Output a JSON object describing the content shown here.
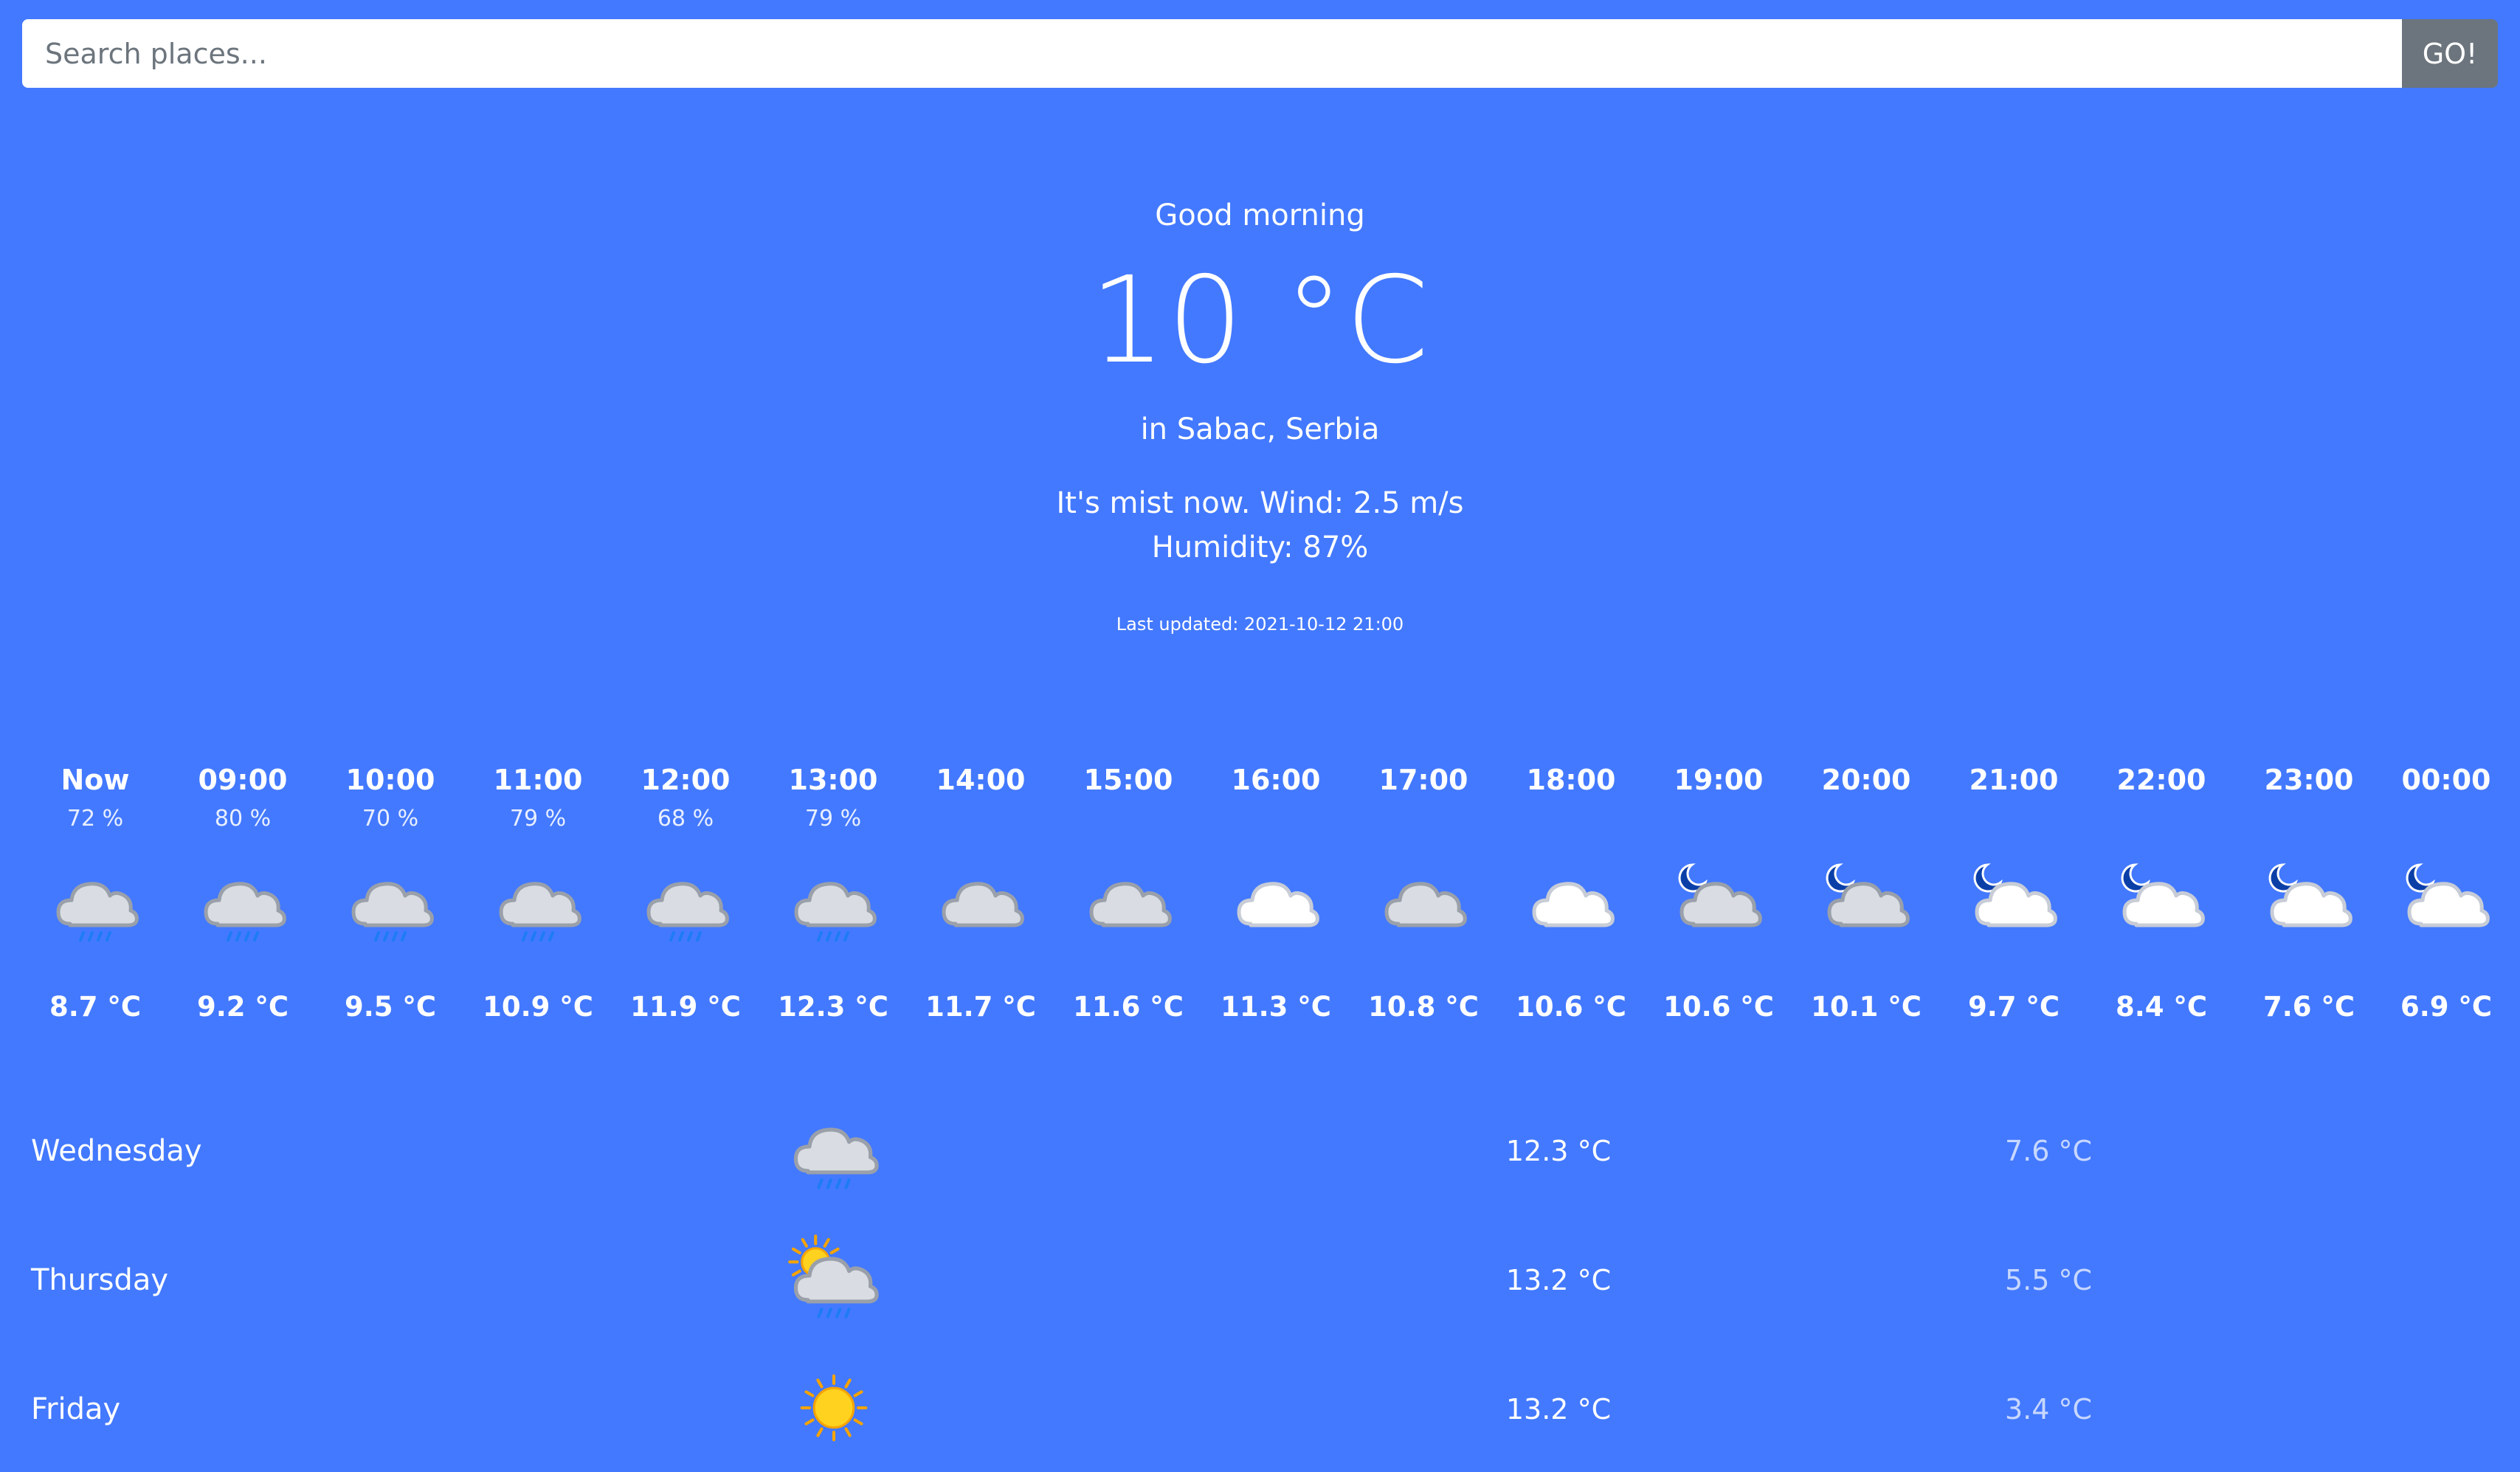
{
  "search": {
    "placeholder": "Search places...",
    "button_label": "GO!"
  },
  "current": {
    "greeting": "Good morning",
    "temperature": "10 °C",
    "location": "in Sabac, Serbia",
    "conditions": "It's mist now. Wind: 2.5 m/s",
    "humidity": "Humidity: 87%",
    "last_updated": "Last updated: 2021-10-12 21:00"
  },
  "hourly": [
    {
      "time": "Now",
      "humidity": "72 %",
      "icon": "rain-cloud-icon",
      "temp": "8.7 °C"
    },
    {
      "time": "09:00",
      "humidity": "80 %",
      "icon": "rain-cloud-icon",
      "temp": "9.2 °C"
    },
    {
      "time": "10:00",
      "humidity": "70 %",
      "icon": "rain-cloud-icon",
      "temp": "9.5 °C"
    },
    {
      "time": "11:00",
      "humidity": "79 %",
      "icon": "rain-cloud-icon",
      "temp": "10.9 °C"
    },
    {
      "time": "12:00",
      "humidity": "68 %",
      "icon": "rain-cloud-icon",
      "temp": "11.9 °C"
    },
    {
      "time": "13:00",
      "humidity": "79 %",
      "icon": "rain-cloud-icon",
      "temp": "12.3 °C"
    },
    {
      "time": "14:00",
      "humidity": "",
      "icon": "cloud-icon",
      "temp": "11.7 °C"
    },
    {
      "time": "15:00",
      "humidity": "",
      "icon": "cloud-icon",
      "temp": "11.6 °C"
    },
    {
      "time": "16:00",
      "humidity": "",
      "icon": "white-cloud-icon",
      "temp": "11.3 °C"
    },
    {
      "time": "17:00",
      "humidity": "",
      "icon": "cloud-icon",
      "temp": "10.8 °C"
    },
    {
      "time": "18:00",
      "humidity": "",
      "icon": "white-cloud-icon",
      "temp": "10.6 °C"
    },
    {
      "time": "19:00",
      "humidity": "",
      "icon": "moon-cloud-icon",
      "temp": "10.6 °C"
    },
    {
      "time": "20:00",
      "humidity": "",
      "icon": "moon-cloud-icon",
      "temp": "10.1 °C"
    },
    {
      "time": "21:00",
      "humidity": "",
      "icon": "moon-white-cloud-icon",
      "temp": "9.7 °C"
    },
    {
      "time": "22:00",
      "humidity": "",
      "icon": "moon-white-cloud-icon",
      "temp": "8.4 °C"
    },
    {
      "time": "23:00",
      "humidity": "",
      "icon": "moon-white-cloud-icon",
      "temp": "7.6 °C"
    },
    {
      "time": "00:00",
      "humidity": "",
      "icon": "moon-white-cloud-icon",
      "temp": "6.9 °C"
    }
  ],
  "daily": [
    {
      "day": "Wednesday",
      "icon": "rain-cloud-icon",
      "high": "12.3 °C",
      "low": "7.6 °C"
    },
    {
      "day": "Thursday",
      "icon": "sun-rain-cloud-icon",
      "high": "13.2 °C",
      "low": "5.5 °C"
    },
    {
      "day": "Friday",
      "icon": "sun-icon",
      "high": "13.2 °C",
      "low": "3.4 °C"
    }
  ],
  "colors": {
    "background": "#4379FF",
    "button": "#6c757d"
  }
}
